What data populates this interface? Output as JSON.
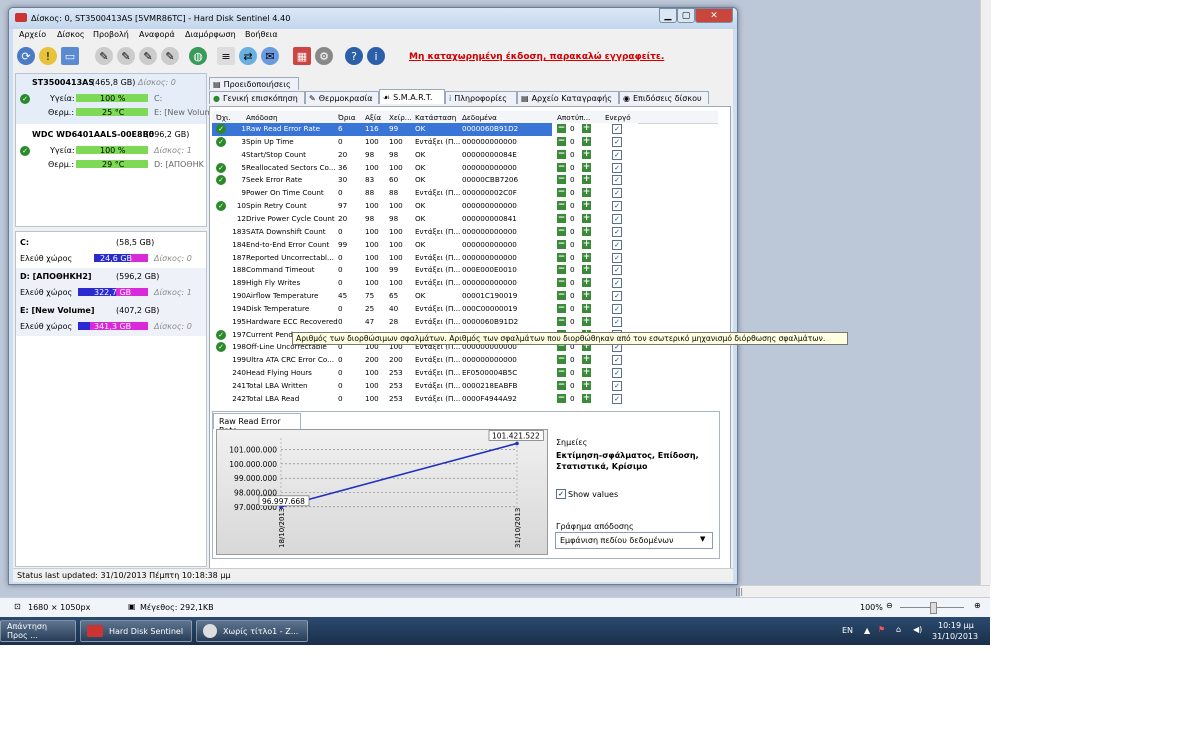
{
  "window": {
    "title": "Δίσκος: 0, ST3500413AS [5VMR86TC]  -  Hard Disk Sentinel 4.40",
    "menu": [
      "Αρχείο",
      "Δίσκος",
      "Προβολή",
      "Αναφορά",
      "Διαμόρφωση",
      "Βοήθεια"
    ],
    "unregistered_notice": "Μη καταχωρημένη έκδοση, παρακαλώ εγγραφείτε."
  },
  "disks": [
    {
      "name": "ST3500413AS",
      "size": "(465,8 GB)",
      "disk_index": "Δίσκος: 0",
      "health_label": "Υγεία:",
      "health_value": "100 %",
      "health_drive": "C:",
      "temp_label": "Θερμ.:",
      "temp_value": "25 °C",
      "temp_drive": "E: [New Volum"
    },
    {
      "name": "WDC WD6401AALS-00E8B0",
      "size": "(596,2 GB)",
      "disk_index": "",
      "health_label": "Υγεία:",
      "health_value": "100 %",
      "health_drive": "Δίσκος: 1",
      "temp_label": "Θερμ.:",
      "temp_value": "29 °C",
      "temp_drive": "D: [ΑΠΟΘΗΚ"
    }
  ],
  "volumes": [
    {
      "name": "C:",
      "size": "(58,5 GB)",
      "free_label": "Ελεύθ χώρος",
      "free_value": "",
      "disk": "",
      "fill_pct": 0
    },
    {
      "name": "D: [ΑΠΟΘΗΚΗ2]",
      "size": "(596,2 GB)",
      "free_label": "Ελεύθ χώρος",
      "free_value": "322,7 GB",
      "disk": "Δίσκος: 1",
      "fill_pct": 46
    },
    {
      "name": "E: [New Volume]",
      "size": "(407,2 GB)",
      "free_label": "Ελεύθ χώρος",
      "free_value": "341,3 GB",
      "disk": "Δίσκος: 0",
      "fill_pct": 16
    }
  ],
  "volume_c_free": "24,6 GB",
  "volume_c_disk": "Δίσκος: 0",
  "tabs_top": [
    "Προειδοποιήσεις"
  ],
  "tabs": [
    "Γενική επισκόπηση",
    "Θερμοκρασία",
    "S.M.A.R.T.",
    "Πληροφορίες",
    "Αρχείο Καταγραφής",
    "Επιδόσεις δίσκου"
  ],
  "smart_headers": [
    "Όχι.",
    "Απόδοση",
    "Όρια",
    "Αξία",
    "Χείρ...",
    "Κατάσταση",
    "Δεδομένα",
    "Αποτύπ...",
    "Ενεργό"
  ],
  "smart_rows": [
    {
      "id": "1",
      "name": "Raw Read Error Rate",
      "thr": "6",
      "val": "116",
      "worst": "99",
      "status": "OK",
      "data": "0000060B91D2",
      "ok": true
    },
    {
      "id": "3",
      "name": "Spin Up Time",
      "thr": "0",
      "val": "100",
      "worst": "100",
      "status": "Εντάξει (Π...",
      "data": "000000000000",
      "ok": true
    },
    {
      "id": "4",
      "name": "Start/Stop Count",
      "thr": "20",
      "val": "98",
      "worst": "98",
      "status": "OK",
      "data": "00000000084E",
      "ok": false
    },
    {
      "id": "5",
      "name": "Reallocated Sectors Co...",
      "thr": "36",
      "val": "100",
      "worst": "100",
      "status": "OK",
      "data": "000000000000",
      "ok": true
    },
    {
      "id": "7",
      "name": "Seek Error Rate",
      "thr": "30",
      "val": "83",
      "worst": "60",
      "status": "OK",
      "data": "00000CBB7206",
      "ok": true
    },
    {
      "id": "9",
      "name": "Power On Time Count",
      "thr": "0",
      "val": "88",
      "worst": "88",
      "status": "Εντάξει (Π...",
      "data": "000000002C0F",
      "ok": false
    },
    {
      "id": "10",
      "name": "Spin Retry Count",
      "thr": "97",
      "val": "100",
      "worst": "100",
      "status": "OK",
      "data": "000000000000",
      "ok": true
    },
    {
      "id": "12",
      "name": "Drive Power Cycle Count",
      "thr": "20",
      "val": "98",
      "worst": "98",
      "status": "OK",
      "data": "000000000841",
      "ok": false
    },
    {
      "id": "183",
      "name": "SATA Downshift Count",
      "thr": "0",
      "val": "100",
      "worst": "100",
      "status": "Εντάξει (Π...",
      "data": "000000000000",
      "ok": false
    },
    {
      "id": "184",
      "name": "End-to-End Error Count",
      "thr": "99",
      "val": "100",
      "worst": "100",
      "status": "OK",
      "data": "000000000000",
      "ok": false
    },
    {
      "id": "187",
      "name": "Reported Uncorrectabl...",
      "thr": "0",
      "val": "100",
      "worst": "100",
      "status": "Εντάξει (Π...",
      "data": "000000000000",
      "ok": false
    },
    {
      "id": "188",
      "name": "Command Timeout",
      "thr": "0",
      "val": "100",
      "worst": "99",
      "status": "Εντάξει (Π...",
      "data": "000E000E0010",
      "ok": false
    },
    {
      "id": "189",
      "name": "High Fly Writes",
      "thr": "0",
      "val": "100",
      "worst": "100",
      "status": "Εντάξει (Π...",
      "data": "000000000000",
      "ok": false
    },
    {
      "id": "190",
      "name": "Airflow Temperature",
      "thr": "45",
      "val": "75",
      "worst": "65",
      "status": "OK",
      "data": "00001C190019",
      "ok": false
    },
    {
      "id": "194",
      "name": "Disk Temperature",
      "thr": "0",
      "val": "25",
      "worst": "40",
      "status": "Εντάξει (Π...",
      "data": "000C00000019",
      "ok": false
    },
    {
      "id": "195",
      "name": "Hardware ECC Recovered",
      "thr": "0",
      "val": "47",
      "worst": "28",
      "status": "Εντάξει (Π...",
      "data": "0000060B91D2",
      "ok": false
    },
    {
      "id": "197",
      "name": "Current Pend...",
      "thr": "",
      "val": "",
      "worst": "",
      "status": "",
      "data": "",
      "ok": true
    },
    {
      "id": "198",
      "name": "Off-Line Uncorrectable",
      "thr": "0",
      "val": "100",
      "worst": "100",
      "status": "Εντάξει (Π...",
      "data": "000000000000",
      "ok": true
    },
    {
      "id": "199",
      "name": "Ultra ATA CRC Error Co...",
      "thr": "0",
      "val": "200",
      "worst": "200",
      "status": "Εντάξει (Π...",
      "data": "000000000000",
      "ok": false
    },
    {
      "id": "240",
      "name": "Head Flying Hours",
      "thr": "0",
      "val": "100",
      "worst": "253",
      "status": "Εντάξει (Π...",
      "data": "EF0500004B5C",
      "ok": false
    },
    {
      "id": "241",
      "name": "Total LBA Written",
      "thr": "0",
      "val": "100",
      "worst": "253",
      "status": "Εντάξει (Π...",
      "data": "0000218EABFB",
      "ok": false
    },
    {
      "id": "242",
      "name": "Total LBA Read",
      "thr": "0",
      "val": "100",
      "worst": "253",
      "status": "Εντάξει (Π...",
      "data": "0000F4944A92",
      "ok": false
    }
  ],
  "row_threshold_count": "0",
  "tooltip": "Αριθμός των διορθώσιμων σφαλμάτων. Αριθμός των σφαλμάτων που διορθώθηκαν από τον εσωτερικό μηχανισμό διόρθωσης σφαλμάτων.",
  "graph": {
    "tab_label": "Raw Read Error Rate",
    "notes_label": "Σημείες",
    "notes_bold": "Εκτίμηση-σφάλματος, Επίδοση, Στατιστικά, Κρίσιμο",
    "show_values": "Show values",
    "perf_label": "Γράφημα απόδοσης",
    "dropdown_value": "Εμφάνιση πεδίου δεδομένων"
  },
  "chart_data": {
    "type": "line",
    "x": [
      "18/10/2013",
      "31/10/2013"
    ],
    "series": [
      {
        "values": [
          96997668,
          101421522
        ]
      }
    ],
    "y_ticks": [
      "97.000.000",
      "98.000.000",
      "99.000.000",
      "100.000.000",
      "101.000.000"
    ],
    "point_labels": [
      "96.997.668",
      "101.421.522"
    ],
    "ylim": [
      96500000,
      101800000
    ],
    "grid": true,
    "color": "#1f2fbf"
  },
  "status": "Status last updated: 31/10/2013 Πέμπτη 10:18:38 μμ",
  "paint_status": {
    "dims": "1680 × 1050px",
    "size": "Μέγεθος: 292,1KB",
    "zoom": "100%"
  },
  "taskbar": {
    "items": [
      "Απάντηση Προς ...",
      "Hard Disk Sentinel",
      "Χωρίς τίτλο1 - Z..."
    ],
    "lang": "EN",
    "time": "10:19 μμ",
    "date": "31/10/2013"
  },
  "colors": {
    "health_green": "#7ed957",
    "free_blue": "#2a2acf",
    "free_magenta": "#d92ad9",
    "link_red": "#d40000"
  }
}
